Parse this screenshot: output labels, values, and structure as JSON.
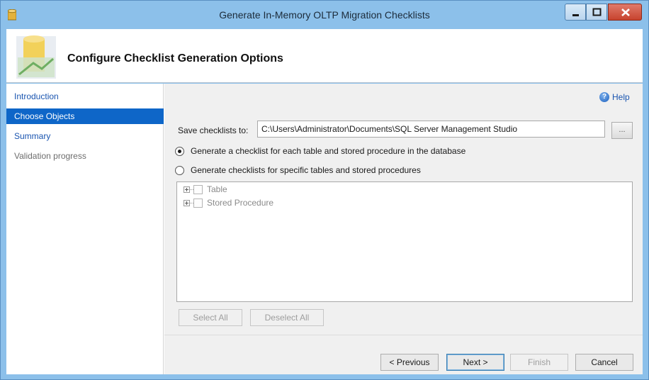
{
  "window": {
    "title": "Generate In-Memory OLTP Migration Checklists",
    "controls": [
      "minimize-icon",
      "maximize-icon",
      "close-icon"
    ]
  },
  "header": {
    "title": "Configure Checklist Generation Options"
  },
  "sidebar": {
    "items": [
      {
        "label": "Introduction",
        "state": "link"
      },
      {
        "label": "Choose Objects",
        "state": "selected"
      },
      {
        "label": "Summary",
        "state": "link"
      },
      {
        "label": "Validation progress",
        "state": "disabled"
      }
    ]
  },
  "content": {
    "help_label": "Help",
    "save_label": "Save checklists to:",
    "save_path": "C:\\Users\\Administrator\\Documents\\SQL Server Management Studio",
    "browse_label": "...",
    "radio_options": [
      {
        "label": "Generate a checklist for each table and stored procedure in the database",
        "checked": true
      },
      {
        "label": "Generate checklists for specific tables and stored procedures",
        "checked": false
      }
    ],
    "tree": [
      {
        "label": "Table",
        "checked": false
      },
      {
        "label": "Stored Procedure",
        "checked": false
      }
    ],
    "select_all_label": "Select All",
    "deselect_all_label": "Deselect All"
  },
  "footer": {
    "previous_label": "< Previous",
    "next_label": "Next >",
    "finish_label": "Finish",
    "cancel_label": "Cancel"
  },
  "colors": {
    "titlebar": "#8cc0ea",
    "selected_nav": "#0e66c8",
    "link": "#1a55b0",
    "content_bg": "#f0f0f0"
  }
}
